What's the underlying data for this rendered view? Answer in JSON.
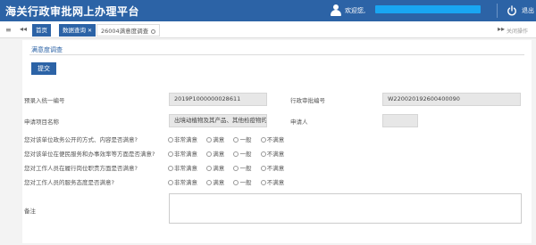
{
  "header": {
    "app_title": "海关行政审批网上办理平台",
    "welcome": "欢迎您,",
    "logout": "退出",
    "accent_color": "#2c63a6",
    "redaction_color": "#19a6f2"
  },
  "tabs": {
    "menu_glyph": "≡",
    "back_glyph": "◂◂",
    "forward_glyph": "▸▸",
    "home": "首页",
    "query": "数据查询",
    "query_close": "✕",
    "survey": "26004满意度调查",
    "close_ops": "关闭操作"
  },
  "panel": {
    "title": "满意度调查",
    "submit": "提交"
  },
  "form": {
    "entry_no_label": "预录入统一编号",
    "entry_no_value": "2019P1000000028611",
    "approval_no_label": "行政审批编号",
    "approval_no_value": "W220020192600400090",
    "project_name_label": "申请项目名称",
    "project_name_value": "出境动植物及其产品、其他检疫物的生产",
    "applicant_label": "申请人",
    "applicant_value": ""
  },
  "questions": [
    {
      "text": "您对该单位政务公开的方式、内容是否满意?"
    },
    {
      "text": "您对该单位在便民服务和办事效率等方面是否满意?"
    },
    {
      "text": "您对工作人员在履行岗位职责方面是否满意?"
    },
    {
      "text": "您对工作人员的服务态度是否满意?"
    }
  ],
  "rating_options": [
    "非常满意",
    "满意",
    "一般",
    "不满意"
  ],
  "remark_label": "备注"
}
